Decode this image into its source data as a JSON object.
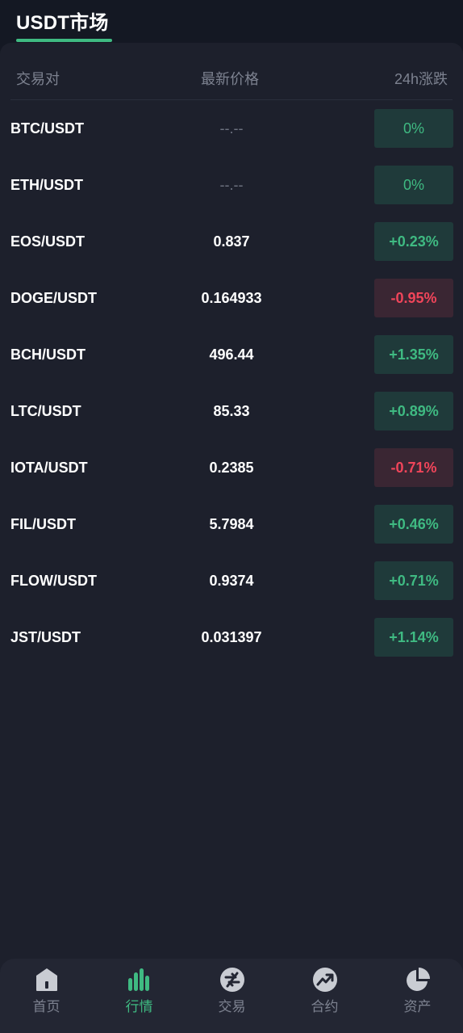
{
  "header": {
    "title": "USDT市场"
  },
  "columns": {
    "pair": "交易对",
    "price": "最新价格",
    "change": "24h涨跌"
  },
  "rows": [
    {
      "pair": "BTC/USDT",
      "price": "--.--",
      "change": "0%",
      "trend": "flat"
    },
    {
      "pair": "ETH/USDT",
      "price": "--.--",
      "change": "0%",
      "trend": "flat"
    },
    {
      "pair": "EOS/USDT",
      "price": "0.837",
      "change": "+0.23%",
      "trend": "up"
    },
    {
      "pair": "DOGE/USDT",
      "price": "0.164933",
      "change": "-0.95%",
      "trend": "down"
    },
    {
      "pair": "BCH/USDT",
      "price": "496.44",
      "change": "+1.35%",
      "trend": "up"
    },
    {
      "pair": "LTC/USDT",
      "price": "85.33",
      "change": "+0.89%",
      "trend": "up"
    },
    {
      "pair": "IOTA/USDT",
      "price": "0.2385",
      "change": "-0.71%",
      "trend": "down"
    },
    {
      "pair": "FIL/USDT",
      "price": "5.7984",
      "change": "+0.46%",
      "trend": "up"
    },
    {
      "pair": "FLOW/USDT",
      "price": "0.9374",
      "change": "+0.71%",
      "trend": "up"
    },
    {
      "pair": "JST/USDT",
      "price": "0.031397",
      "change": "+1.14%",
      "trend": "up"
    }
  ],
  "nav": [
    {
      "label": "首页",
      "icon": "home-icon",
      "active": false
    },
    {
      "label": "行情",
      "icon": "bar-chart-icon",
      "active": true
    },
    {
      "label": "交易",
      "icon": "exchange-icon",
      "active": false
    },
    {
      "label": "合约",
      "icon": "trend-up-icon",
      "active": false
    },
    {
      "label": "资产",
      "icon": "pie-chart-icon",
      "active": false
    }
  ],
  "colors": {
    "accent": "#3fba82",
    "down": "#f0455a",
    "up_bg": "#1f3a3a",
    "down_bg": "#3a2633",
    "background": "#1d202c"
  }
}
